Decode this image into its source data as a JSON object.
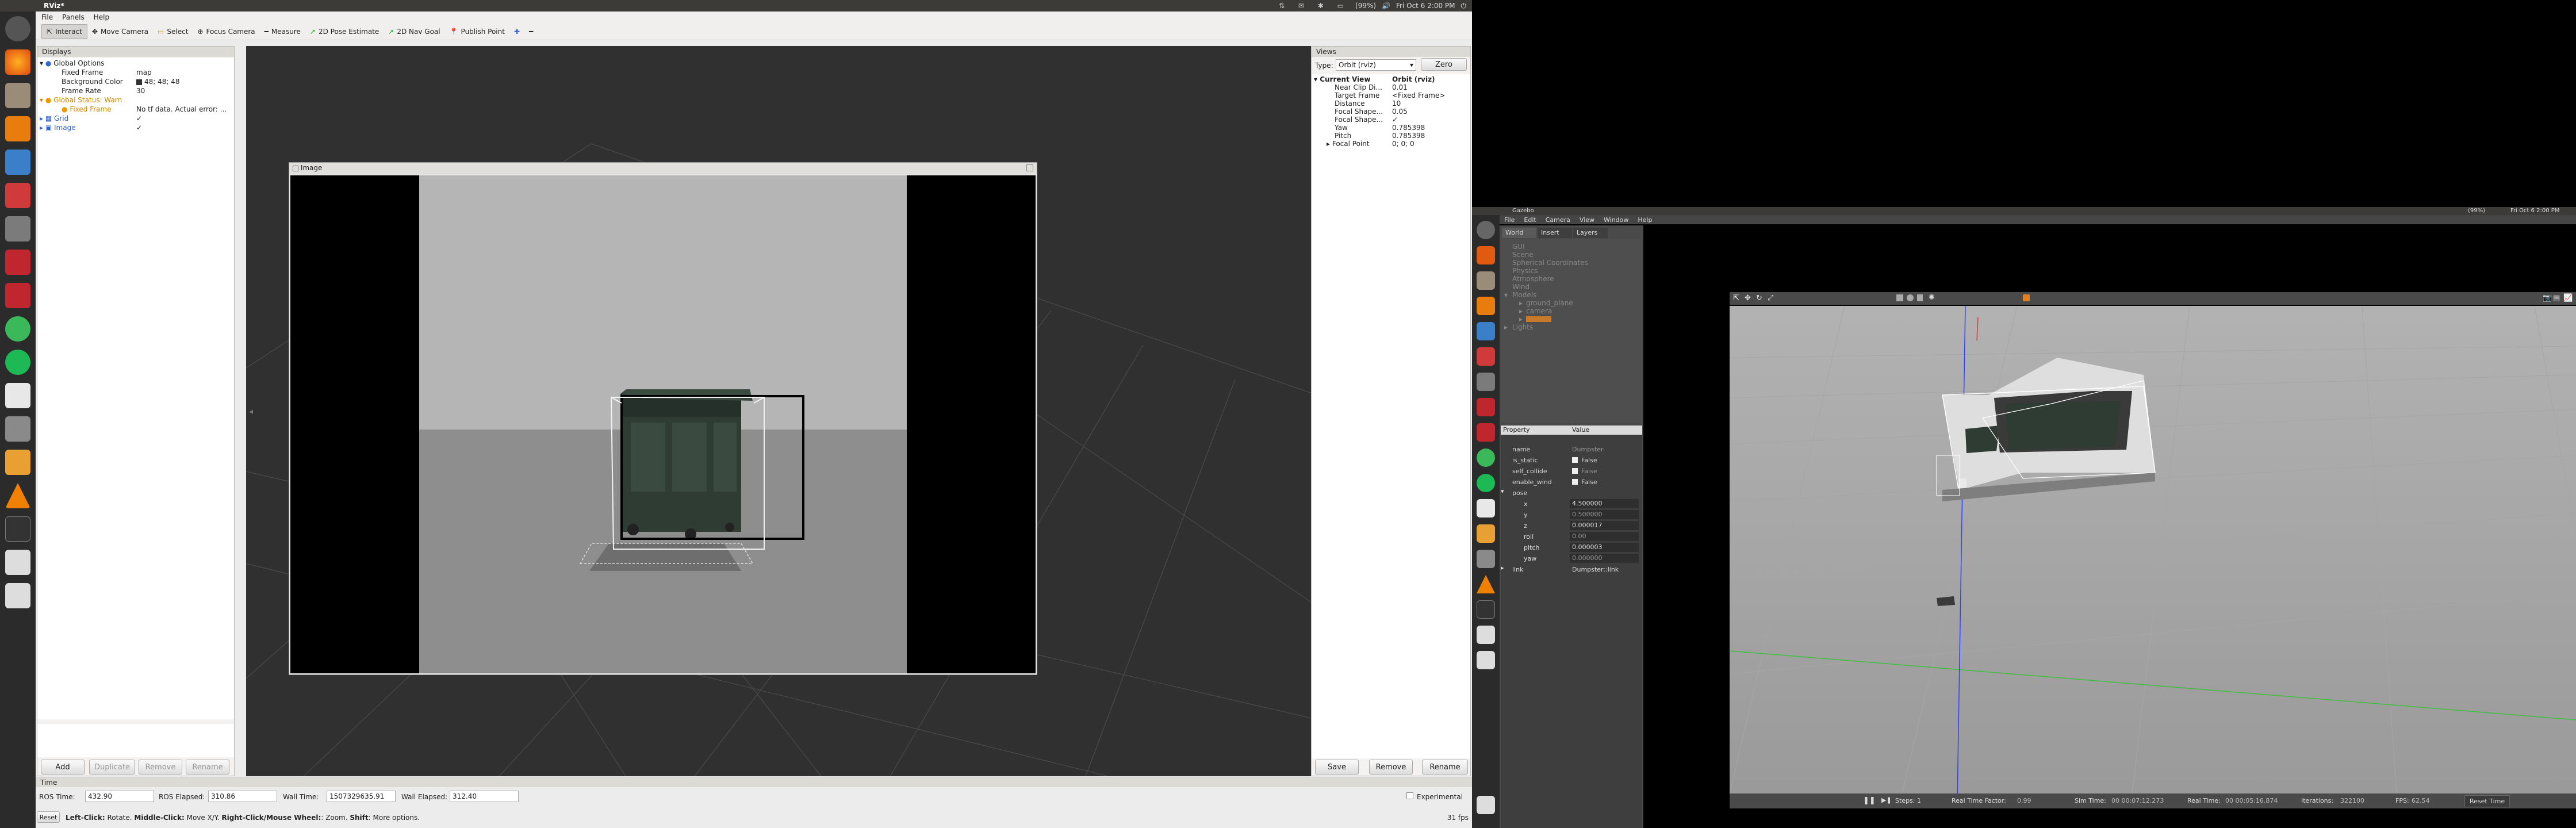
{
  "topbar": {
    "title": "RViz*",
    "clock": "Fri Oct 6 2:00 PM",
    "battery": "(99%)"
  },
  "rviz": {
    "menu": [
      "File",
      "Panels",
      "Help"
    ],
    "toolbar": [
      "Interact",
      "Move Camera",
      "Select",
      "Focus Camera",
      "Measure",
      "2D Pose Estimate",
      "2D Nav Goal",
      "Publish Point"
    ],
    "displays": {
      "title": "Displays",
      "rows": [
        {
          "label": "Global Options",
          "value": ""
        },
        {
          "label": "Fixed Frame",
          "value": "map"
        },
        {
          "label": "Background Color",
          "value": "48; 48; 48"
        },
        {
          "label": "Frame Rate",
          "value": "30"
        },
        {
          "label": "Global Status: Warn",
          "value": ""
        },
        {
          "label": "Fixed Frame",
          "value": "No tf data.  Actual error: ..."
        },
        {
          "label": "Grid",
          "value": "✓"
        },
        {
          "label": "Image",
          "value": "✓"
        }
      ],
      "buttons": [
        "Add",
        "Duplicate",
        "Remove",
        "Rename"
      ]
    },
    "image_window": {
      "title": "Image"
    },
    "views": {
      "title": "Views",
      "type_label": "Type:",
      "type_value": "Orbit (rviz)",
      "zero": "Zero",
      "rows": [
        {
          "label": "Current View",
          "value": "Orbit (rviz)"
        },
        {
          "label": "Near Clip Di...",
          "value": "0.01"
        },
        {
          "label": "Target Frame",
          "value": "<Fixed Frame>"
        },
        {
          "label": "Distance",
          "value": "10"
        },
        {
          "label": "Focal Shape...",
          "value": "0.05"
        },
        {
          "label": "Focal Shape...",
          "value": "✓"
        },
        {
          "label": "Yaw",
          "value": "0.785398"
        },
        {
          "label": "Pitch",
          "value": "0.785398"
        },
        {
          "label": "Focal Point",
          "value": "0; 0; 0"
        }
      ],
      "buttons": [
        "Save",
        "Remove",
        "Rename"
      ]
    },
    "time": {
      "title": "Time",
      "ros_time_label": "ROS Time:",
      "ros_time": "432.90",
      "ros_elapsed_label": "ROS Elapsed:",
      "ros_elapsed": "310.86",
      "wall_time_label": "Wall Time:",
      "wall_time": "1507329635.91",
      "wall_elapsed_label": "Wall Elapsed:",
      "wall_elapsed": "312.40",
      "experimental": "Experimental"
    },
    "status": {
      "reset": "Reset",
      "hint_a": "Left-Click:",
      "hint_b": " Rotate. ",
      "hint_c": "Middle-Click:",
      "hint_d": " Move X/Y. ",
      "hint_e": "Right-Click/Mouse Wheel:",
      "hint_f": ": Zoom. ",
      "hint_g": "Shift",
      "hint_h": ": More options.",
      "fps": "31 fps"
    }
  },
  "gazebo": {
    "title": "Gazebo",
    "clock": "Fri Oct 6 2:00 PM",
    "battery": "(99%)",
    "menu": [
      "File",
      "Edit",
      "Camera",
      "View",
      "Window",
      "Help"
    ],
    "tabs": [
      "World",
      "Insert",
      "Layers"
    ],
    "tree": [
      "GUI",
      "Scene",
      "Spherical Coordinates",
      "Physics",
      "Atmosphere",
      "Wind",
      "Models",
      "ground_plane",
      "camera",
      "",
      "Lights"
    ],
    "prop_header": [
      "Property",
      "Value"
    ],
    "props": [
      {
        "label": "name",
        "value": "Dumpster"
      },
      {
        "label": "is_static",
        "value": "False"
      },
      {
        "label": "self_collide",
        "value": "False"
      },
      {
        "label": "enable_wind",
        "value": "False"
      },
      {
        "label": "pose",
        "value": ""
      },
      {
        "label": "x",
        "value": "4.500000"
      },
      {
        "label": "y",
        "value": "0.500000"
      },
      {
        "label": "z",
        "value": "0.000017"
      },
      {
        "label": "roll",
        "value": "0.00"
      },
      {
        "label": "pitch",
        "value": "0.000003"
      },
      {
        "label": "yaw",
        "value": "0.000000"
      },
      {
        "label": "link",
        "value": "Dumpster::link"
      }
    ],
    "bottom": {
      "steps": "Steps:",
      "steps_val": "1",
      "rtf_label": "Real Time Factor:",
      "rtf": "0.99",
      "sim_label": "Sim Time:",
      "sim": "00 00:07:12.273",
      "real_label": "Real Time:",
      "real": "00 00:05:16.874",
      "iter_label": "Iterations:",
      "iter": "322100",
      "fps_label": "FPS:",
      "fps": "62.54",
      "reset": "Reset Time"
    }
  }
}
